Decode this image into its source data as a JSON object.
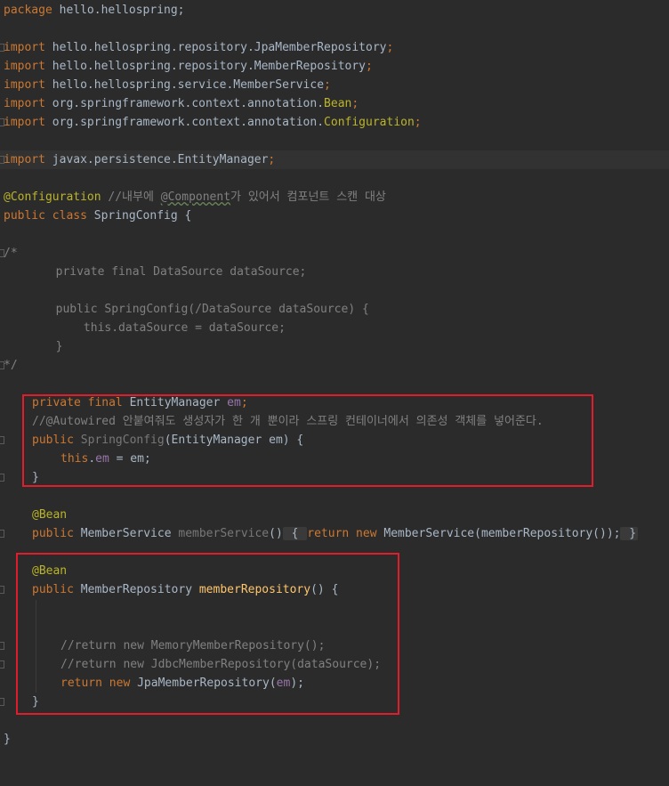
{
  "editor": {
    "line_package": {
      "kw": "package",
      "rest": " hello.hellospring;"
    },
    "imports": [
      {
        "kw": "import",
        "path": " hello.hellospring.repository.JpaMemberRepository",
        "tail": ";"
      },
      {
        "kw": "import",
        "path": " hello.hellospring.repository.MemberRepository",
        "tail": ";"
      },
      {
        "kw": "import",
        "path": " hello.hellospring.service.MemberService",
        "tail": ";"
      },
      {
        "kw": "import",
        "path": " org.springframework.context.annotation.",
        "cls": "Bean",
        "tail": ";"
      },
      {
        "kw": "import",
        "path": " org.springframework.context.annotation.",
        "cls": "Configuration",
        "tail": ";"
      },
      {
        "kw": "import",
        "path": " javax.persistence.EntityManager",
        "tail": ";"
      }
    ],
    "config_annotation": "@Configuration",
    "config_comment": " //내부에 ",
    "config_comment_component": "@Component",
    "config_comment_rest": "가 있어서 컴포넌트 스캔 대상",
    "class_kw": "public class",
    "class_name": " SpringConfig {",
    "block_comment_open": "/*",
    "block_comment_lines": [
      "        private final DataSource dataSource;",
      "",
      "        public SpringConfig(/DataSource dataSource) {",
      "            this.dataSource = dataSource;",
      "        }"
    ],
    "block_comment_close": "*/",
    "em_field": {
      "kw": "private final",
      "type": " EntityManager ",
      "name": "em",
      "tail": ";"
    },
    "autowired_comment": "//@Autowired 안붙여줘도 생성자가 한 개 뿐이라 스프링 컨테이너에서 의존성 객체를 넣어준다.",
    "ctor": {
      "kw": "public",
      "name": " SpringConfig",
      "params": "(EntityManager em) {"
    },
    "ctor_body": {
      "kw": "this",
      "dot": ".",
      "field": "em",
      "rest": " = em;"
    },
    "ctor_close": "}",
    "bean1": "@Bean",
    "member_service": {
      "kw": "public",
      "type": " MemberService ",
      "name": "memberService",
      "paren": "()",
      "fold_open": " { ",
      "ret": "return new",
      "body": " MemberService(memberRepository());",
      "fold_close": " }"
    },
    "bean2": "@Bean",
    "member_repo": {
      "kw": "public",
      "type": " MemberRepository ",
      "name": "memberRepository",
      "rest": "() {"
    },
    "comment_memory": "//return new MemoryMemberRepository();",
    "comment_jdbc": "//return new JdbcMemberRepository(dataSource);",
    "return_jpa": {
      "kw": "return new",
      "body": " JpaMemberRepository(",
      "arg": "em",
      "tail": ");"
    },
    "repo_close": "}",
    "class_close": "}"
  }
}
